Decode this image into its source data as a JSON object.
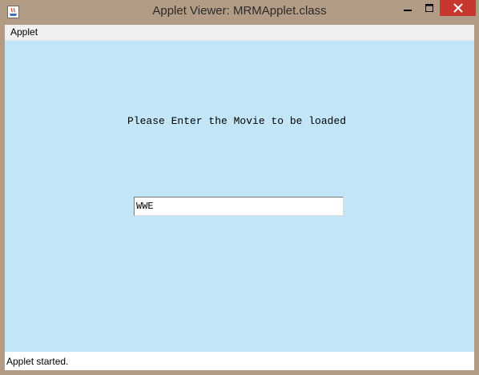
{
  "window": {
    "title": "Applet Viewer: MRMApplet.class",
    "icon": "java-applet-icon",
    "controls": {
      "minimize_icon": "minimize-icon",
      "maximize_icon": "maximize-icon",
      "close_icon": "close-icon"
    }
  },
  "menubar": {
    "items": [
      {
        "label": "Applet"
      }
    ]
  },
  "applet": {
    "background_color": "#c2e6f8",
    "prompt": "Please Enter the Movie to be loaded",
    "movie_input": {
      "value": "WWE"
    }
  },
  "statusbar": {
    "text": "Applet started."
  },
  "colors": {
    "titlebar": "#b39c85",
    "close_button": "#c7372f"
  }
}
